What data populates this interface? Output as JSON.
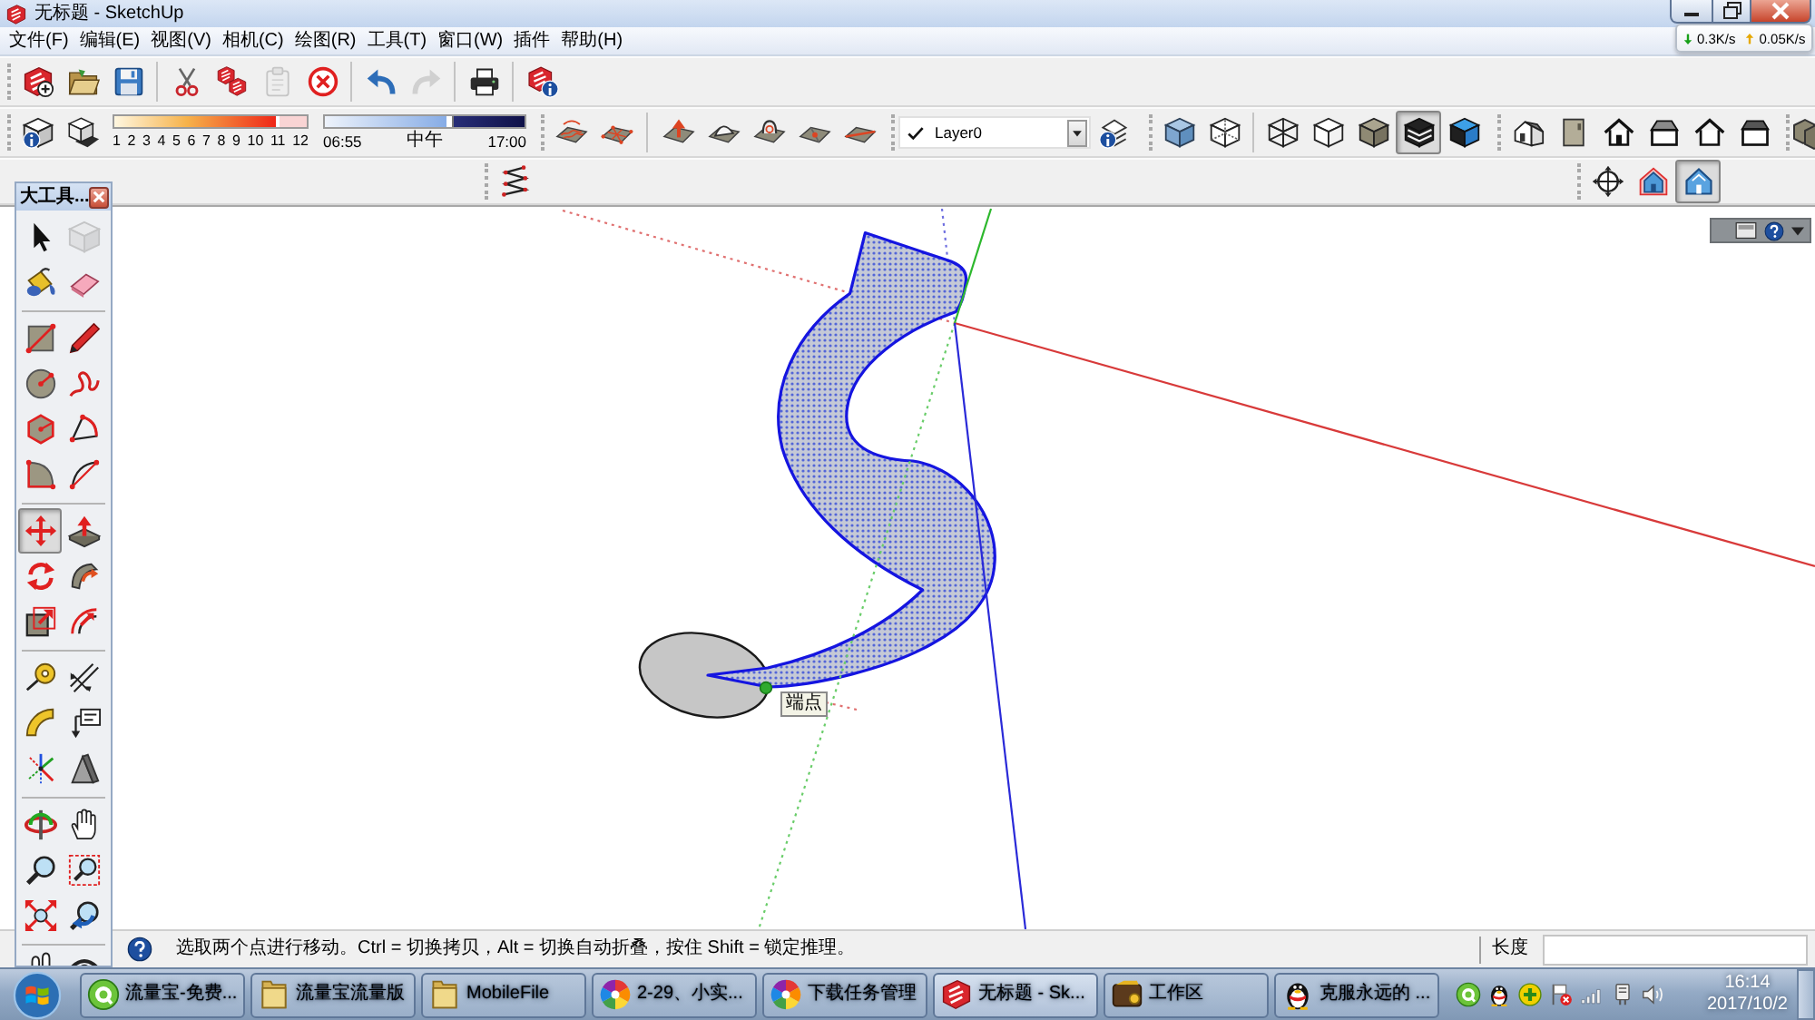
{
  "window": {
    "title": "无标题 - SketchUp"
  },
  "net_speed": {
    "download": "0.3K/s",
    "upload": "0.05K/s"
  },
  "menu": [
    "文件(F)",
    "编辑(E)",
    "视图(V)",
    "相机(C)",
    "绘图(R)",
    "工具(T)",
    "窗口(W)",
    "插件",
    "帮助(H)"
  ],
  "standard_toolbar": [
    {
      "disabled": false
    },
    {
      "disabled": false
    },
    {
      "disabled": false
    },
    {
      "disabled": false
    },
    {
      "disabled": false
    },
    {
      "disabled": true
    },
    {
      "disabled": false
    },
    {
      "disabled": false
    },
    {
      "disabled": true
    },
    {
      "disabled": false
    },
    {
      "disabled": false
    }
  ],
  "shadows": {
    "month_slider": {
      "level": 0.86,
      "labels": [
        "1",
        "2",
        "3",
        "4",
        "5",
        "6",
        "7",
        "8",
        "9",
        "10",
        "11",
        "12"
      ]
    },
    "time_slider": {
      "level": 0.64,
      "labels": [
        "06:55",
        "中午",
        "17:00"
      ]
    }
  },
  "layers": {
    "current": "Layer0"
  },
  "style_toolbar": [
    {
      "selected": false
    },
    {
      "selected": false
    },
    {
      "selected": false
    },
    {
      "selected": false
    },
    {
      "selected": false
    },
    {
      "selected": true
    },
    {
      "selected": false
    }
  ],
  "camera_toolbar": [
    {
      "selected": false
    },
    {
      "selected": false
    },
    {
      "selected": true
    }
  ],
  "tool_palette": {
    "title": "大工具...",
    "tools": [
      {
        "selected": false,
        "disabled": false
      },
      {
        "selected": false,
        "disabled": true
      },
      {
        "selected": false,
        "disabled": false
      },
      {
        "selected": false,
        "disabled": false
      },
      {
        "selected": false,
        "disabled": false
      },
      {
        "selected": false,
        "disabled": false
      },
      {
        "selected": false,
        "disabled": false
      },
      {
        "selected": false,
        "disabled": false
      },
      {
        "selected": false,
        "disabled": false
      },
      {
        "selected": false,
        "disabled": false
      },
      {
        "selected": false,
        "disabled": false
      },
      {
        "selected": false,
        "disabled": false
      },
      {
        "selected": true,
        "disabled": false
      },
      {
        "selected": false,
        "disabled": false
      },
      {
        "selected": false,
        "disabled": false
      },
      {
        "selected": false,
        "disabled": false
      },
      {
        "selected": false,
        "disabled": false
      },
      {
        "selected": false,
        "disabled": false
      },
      {
        "selected": false,
        "disabled": false
      },
      {
        "selected": false,
        "disabled": false
      },
      {
        "selected": false,
        "disabled": false
      },
      {
        "selected": false,
        "disabled": false
      },
      {
        "selected": false,
        "disabled": false
      },
      {
        "selected": false,
        "disabled": false
      },
      {
        "selected": false,
        "disabled": false
      },
      {
        "selected": false,
        "disabled": false
      },
      {
        "selected": false,
        "disabled": false
      },
      {
        "selected": false,
        "disabled": false
      },
      {
        "selected": false,
        "disabled": false
      },
      {
        "selected": false,
        "disabled": false
      },
      {
        "selected": false,
        "disabled": false
      },
      {
        "selected": false,
        "disabled": false
      }
    ]
  },
  "viewport": {
    "tooltip": "端点"
  },
  "status_bar": {
    "hint": "选取两个点进行移动。Ctrl = 切换拷贝，Alt = 切换自动折叠，按住 Shift = 锁定推理。",
    "measure_label": "长度"
  },
  "taskbar": {
    "items": [
      {
        "label": "流量宝-免费...",
        "selected": false
      },
      {
        "label": "流量宝流量版",
        "selected": false
      },
      {
        "label": "MobileFile",
        "selected": false
      },
      {
        "label": "2-29、小实...",
        "selected": false
      },
      {
        "label": "下载任务管理",
        "selected": false
      },
      {
        "label": "无标题 - Sk...",
        "selected": true
      },
      {
        "label": "工作区",
        "selected": false
      },
      {
        "label": "克服永远的 ...",
        "selected": false
      }
    ],
    "time": "16:14",
    "date": "2017/10/2"
  }
}
